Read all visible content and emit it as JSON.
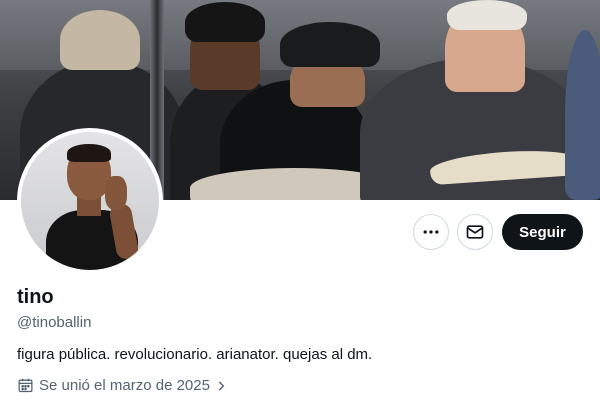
{
  "profile": {
    "display_name": "tino",
    "handle": "@tinoballin",
    "bio": "figura pública. revolucionario. arianator. quejas al dm.",
    "joined": "Se unió el marzo de 2025"
  },
  "actions": {
    "more_icon": "more-horizontal-icon",
    "message_icon": "envelope-icon",
    "follow_label": "Seguir"
  },
  "icons": {
    "joined": "calendar-icon",
    "joined_expand": "chevron-right-icon"
  },
  "colors": {
    "primary_text": "#0f1419",
    "secondary_text": "#536471",
    "button_border": "#cfd9de",
    "follow_bg": "#0f1419",
    "follow_text": "#ffffff"
  }
}
